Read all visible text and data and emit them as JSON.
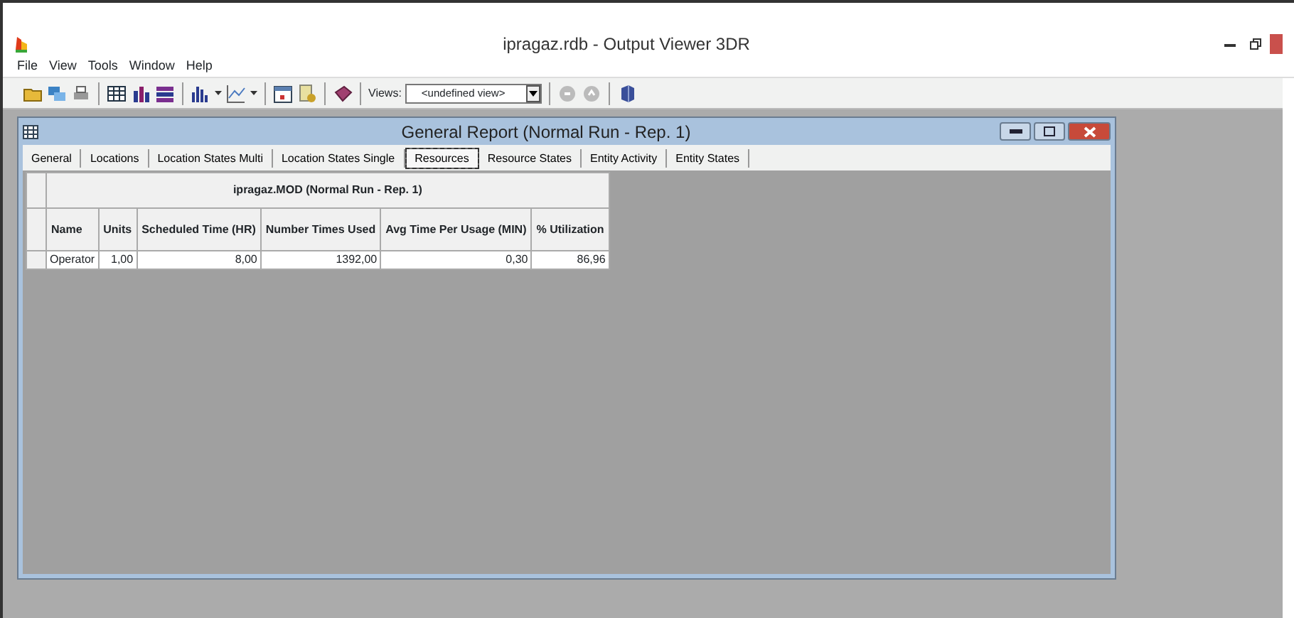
{
  "window": {
    "title": "ipragaz.rdb - Output Viewer 3DR"
  },
  "menu": [
    "File",
    "View",
    "Tools",
    "Window",
    "Help"
  ],
  "toolbar": {
    "views_label": "Views:",
    "views_value": "<undefined view>"
  },
  "report_window": {
    "title": "General Report (Normal Run - Rep. 1)",
    "tabs": [
      {
        "label": "General",
        "selected": false
      },
      {
        "label": "Locations",
        "selected": false
      },
      {
        "label": "Location States Multi",
        "selected": false
      },
      {
        "label": "Location States Single",
        "selected": false
      },
      {
        "label": "Resources",
        "selected": true
      },
      {
        "label": "Resource States",
        "selected": false
      },
      {
        "label": "Entity Activity",
        "selected": false
      },
      {
        "label": "Entity States",
        "selected": false
      }
    ],
    "table": {
      "caption": "ipragaz.MOD (Normal Run - Rep. 1)",
      "columns": [
        "Name",
        "Units",
        "Scheduled Time (HR)",
        "Number Times Used",
        "Avg Time Per Usage (MIN)",
        "% Utilization"
      ],
      "rows": [
        [
          "Operator",
          "1,00",
          "8,00",
          "1392,00",
          "0,30",
          "86,96"
        ]
      ]
    }
  }
}
